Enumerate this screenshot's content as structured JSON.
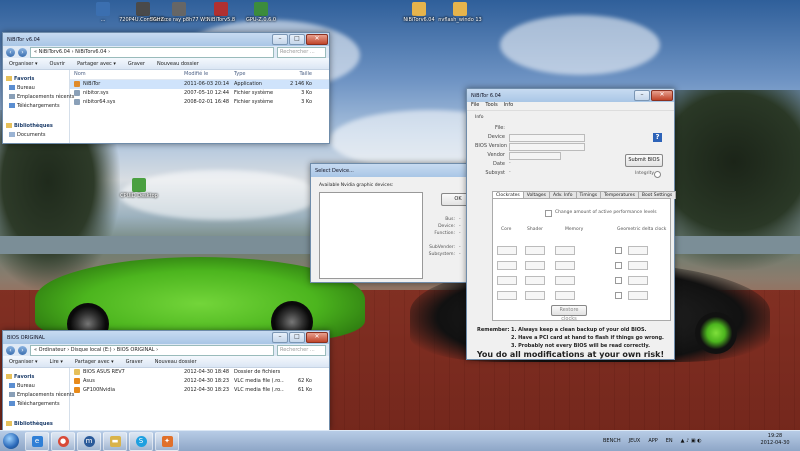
{
  "desktop_icons": [
    {
      "label": "...",
      "color": "#3b6fb0"
    },
    {
      "label": "720P4U.ComMemo",
      "color": "#4a4a4a"
    },
    {
      "label": "5GHZ ce ray p8h77 WS",
      "color": "#666666"
    },
    {
      "label": "NiBiTorv5.8",
      "color": "#b03030"
    },
    {
      "label": "GPU-Z.0.6.0",
      "color": "#3c8c3c"
    },
    {
      "label": "NiBiTorv6.04",
      "color": "#e6b44c"
    },
    {
      "label": "nvflash_windo 13",
      "color": "#e6b44c"
    },
    {
      "label": "CPUID Desktop",
      "color": "#4aa040"
    }
  ],
  "explorer_top": {
    "title": "NiBiTor v6.04",
    "address": "« NiBiTorv6.04 › NiBiTorv6.04 ›",
    "search_placeholder": "Rechercher ...",
    "commands": [
      "Organiser ▾",
      "Ouvrir",
      "Partager avec ▾",
      "Graver",
      "Nouveau dossier"
    ],
    "nav": [
      {
        "label": "Favoris",
        "group": true
      },
      {
        "label": "Bureau",
        "group": false
      },
      {
        "label": "Emplacements récents",
        "group": false
      },
      {
        "label": "Téléchargements",
        "group": false
      },
      {
        "label": "",
        "group": false
      },
      {
        "label": "Bibliothèques",
        "group": true
      },
      {
        "label": "Documents",
        "group": false
      }
    ],
    "columns": [
      "Nom",
      "Modifié le",
      "Type",
      "Taille"
    ],
    "rows": [
      {
        "name": "NiBiTor",
        "date": "2011-06-03 20:14",
        "type": "Application",
        "size": "2 146 Ko",
        "selected": true,
        "icon_color": "#e08b2c"
      },
      {
        "name": "nibitor.sys",
        "date": "2007-05-10 12:44",
        "type": "Fichier système",
        "size": "3 Ko",
        "selected": false,
        "icon_color": "#8aa0b8"
      },
      {
        "name": "nibitor64.sys",
        "date": "2008-02-01 16:48",
        "type": "Fichier système",
        "size": "3 Ko",
        "selected": false,
        "icon_color": "#8aa0b8"
      }
    ]
  },
  "explorer_bottom": {
    "title": "BIOS ORIGINAL",
    "address": "« Ordinateur › Disque local (E:) › BIOS ORIGINAL ›",
    "search_placeholder": "Rechercher ...",
    "commands": [
      "Organiser ▾",
      "Lire ▾",
      "Partager avec ▾",
      "Graver",
      "Nouveau dossier"
    ],
    "nav": [
      {
        "label": "Favoris",
        "group": true
      },
      {
        "label": "Bureau",
        "group": false
      },
      {
        "label": "Emplacements récents",
        "group": false
      },
      {
        "label": "Téléchargements",
        "group": false
      },
      {
        "label": "",
        "group": false
      },
      {
        "label": "Bibliothèques",
        "group": true
      }
    ],
    "rows": [
      {
        "name": "BIOS ASUS REV7",
        "date": "2012-04-30 18:48",
        "type": "Dossier de fichiers",
        "size": "",
        "icon_color": "#e6c05a"
      },
      {
        "name": "Asus",
        "date": "2012-04-30 18:23",
        "type": "VLC media file (.ro...",
        "size": "62 Ko",
        "icon_color": "#e88a1a"
      },
      {
        "name": "GF100Nvidia",
        "date": "2012-04-30 18:23",
        "type": "VLC media file (.ro...",
        "size": "61 Ko",
        "icon_color": "#e88a1a"
      }
    ]
  },
  "select_dialog": {
    "title": "Select Device...",
    "list_label": "Available Nvidia graphic devices:",
    "ok": "OK",
    "info": [
      {
        "label": "Bus:",
        "value": "-"
      },
      {
        "label": "Device:",
        "value": "-"
      },
      {
        "label": "Function:",
        "value": "-"
      },
      {
        "label": "",
        "value": ""
      },
      {
        "label": "SubVender:",
        "value": "-"
      },
      {
        "label": "Subsystem:",
        "value": "-"
      }
    ]
  },
  "nibitor": {
    "title": "NiBiTor 6.04",
    "menu": [
      "File",
      "Tools",
      "Info"
    ],
    "info_label": "Info",
    "fields": [
      "File:",
      "Device",
      "BIOS Version",
      "Vendor",
      "Date",
      "Subsyst"
    ],
    "fields_short": [
      "",
      "",
      "",
      "",
      "-",
      "-"
    ],
    "help": "?",
    "submit": "Submit BIOS",
    "integrity": "Integrity",
    "tabs": [
      "Clockrates",
      "Voltages",
      "Adv. Info",
      "Timings",
      "Temperatures",
      "Boot Settings"
    ],
    "change_perf": "Change amount of active performance levels",
    "cols": [
      "Core",
      "Shader",
      "Memory",
      "Geometric delta clock"
    ],
    "restore": "Restore clocks",
    "remember": "Remember:",
    "reminders": [
      "1.  Always keep a clean backup of your old BIOS.",
      "2.  Have a PCI card at hand to flash if things go wrong.",
      "3.  Probably not every BIOS will be read correctly."
    ],
    "warning": "You do all modifications at your own risk!"
  },
  "taskbar": {
    "buttons": [
      {
        "name": "ie",
        "glyph": "e",
        "color": "#2f7fd6"
      },
      {
        "name": "chrome",
        "glyph": "●",
        "color": "#d84a38"
      },
      {
        "name": "mx",
        "glyph": "m",
        "color": "#2a5a9a"
      },
      {
        "name": "folder",
        "glyph": "▬",
        "color": "#d9b34a"
      },
      {
        "name": "skype",
        "glyph": "S",
        "color": "#1ea0e0"
      },
      {
        "name": "nibitor",
        "glyph": "✦",
        "color": "#e0702a"
      }
    ],
    "tray": [
      "BENCH",
      "JEUX",
      "APP",
      "EN"
    ],
    "time": "19:28",
    "date": "2012-04-30"
  }
}
